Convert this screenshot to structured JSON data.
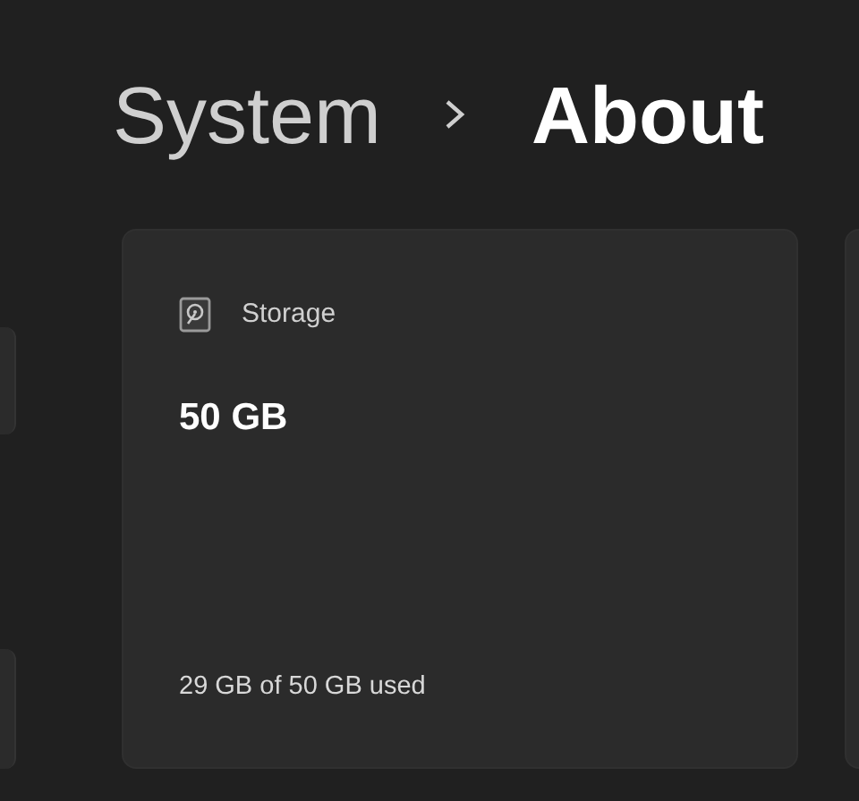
{
  "breadcrumb": {
    "parent": "System",
    "current": "About"
  },
  "cards": [
    {
      "title": "Storage",
      "value": "50 GB",
      "detail": "29 GB of 50 GB used"
    }
  ]
}
